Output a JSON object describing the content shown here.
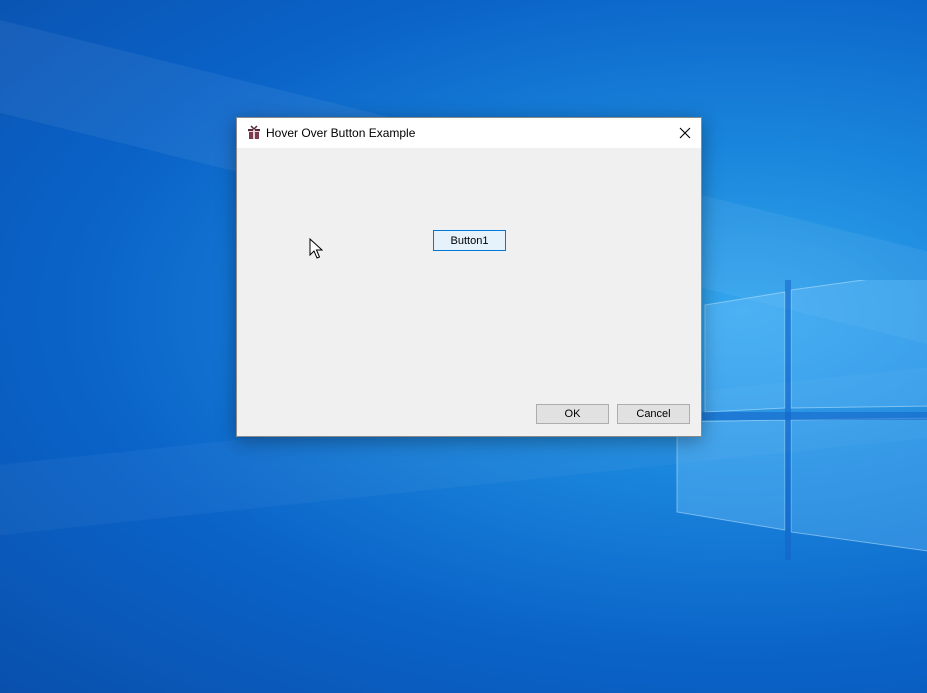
{
  "window": {
    "title": "Hover Over Button Example",
    "app_icon": "gift-icon",
    "close_icon": "close-icon"
  },
  "buttons": {
    "button1_label": "Button1",
    "ok_label": "OK",
    "cancel_label": "Cancel"
  },
  "colors": {
    "desktop_blue": "#0a62c7",
    "window_bg": "#f0f0f0",
    "hover_border": "#0078d7",
    "hover_bg": "#e5f1fb",
    "button_bg": "#e1e1e1"
  },
  "cursor_icon": "arrow-cursor-icon"
}
